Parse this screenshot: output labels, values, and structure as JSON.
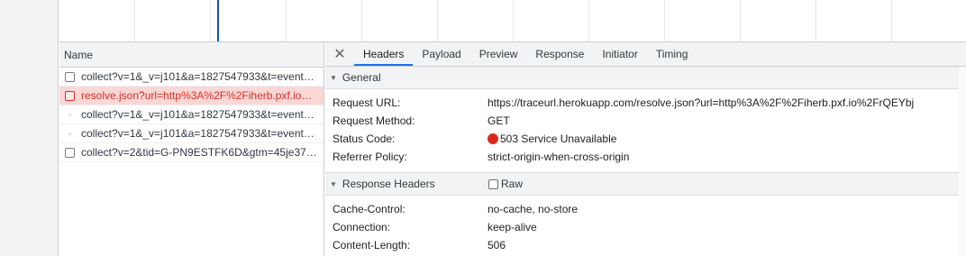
{
  "request_list": {
    "column_header": "Name",
    "rows": [
      {
        "name": "collect?v=1&_v=j101&a=1827547933&t=event…",
        "status": "normal",
        "marker": "checkbox"
      },
      {
        "name": "resolve.json?url=http%3A%2F%2Fiherb.pxf.io…",
        "status": "error",
        "marker": "checkbox"
      },
      {
        "name": "collect?v=1&_v=j101&a=1827547933&t=event…",
        "status": "normal",
        "marker": "dot"
      },
      {
        "name": "collect?v=1&_v=j101&a=1827547933&t=event…",
        "status": "normal",
        "marker": "dot"
      },
      {
        "name": "collect?v=2&tid=G-PN9ESTFK6D&gtm=45je37…",
        "status": "normal",
        "marker": "checkbox"
      }
    ]
  },
  "details": {
    "close_icon": "close-icon",
    "tabs": [
      {
        "label": "Headers",
        "active": true
      },
      {
        "label": "Payload",
        "active": false
      },
      {
        "label": "Preview",
        "active": false
      },
      {
        "label": "Response",
        "active": false
      },
      {
        "label": "Initiator",
        "active": false
      },
      {
        "label": "Timing",
        "active": false
      }
    ],
    "general": {
      "title": "General",
      "request_url_label": "Request URL:",
      "request_url": "https://traceurl.herokuapp.com/resolve.json?url=http%3A%2F%2Fiherb.pxf.io%2FrQEYbj",
      "request_method_label": "Request Method:",
      "request_method": "GET",
      "status_code_label": "Status Code:",
      "status_code": "503 Service Unavailable",
      "status_color": "#d72b1f",
      "referrer_policy_label": "Referrer Policy:",
      "referrer_policy": "strict-origin-when-cross-origin"
    },
    "response_headers": {
      "title": "Response Headers",
      "raw_label": "Raw",
      "cache_control_label": "Cache-Control:",
      "cache_control": "no-cache, no-store",
      "connection_label": "Connection:",
      "connection": "keep-alive",
      "content_length_label": "Content-Length:",
      "content_length": "506"
    }
  }
}
